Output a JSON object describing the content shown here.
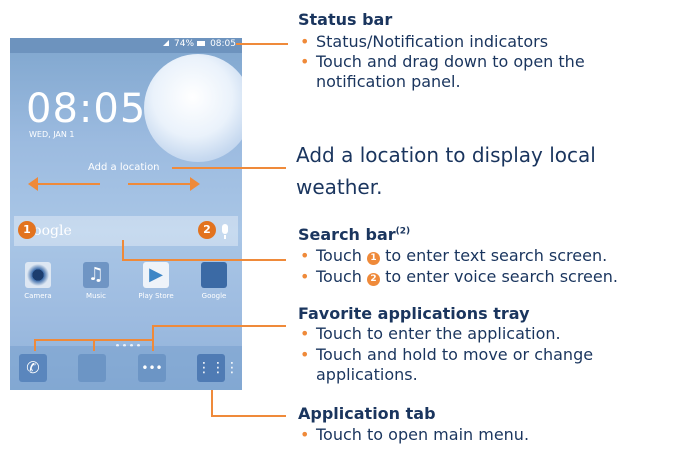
{
  "phone": {
    "battery": "74%",
    "time": "08:05",
    "clock": "08:05",
    "date": "WED, JAN 1",
    "add_location": "Add a location",
    "search_brand": "Google",
    "apps": [
      "Camera",
      "Music",
      "Play Store",
      "Google"
    ],
    "badges": [
      "1",
      "2"
    ]
  },
  "annotations": {
    "status_bar": {
      "title": "Status bar",
      "items": [
        "Status/Notification indicators",
        "Touch and drag down to open the",
        "notification panel."
      ]
    },
    "location": {
      "line1": "Add a location to display local",
      "line2": "weather."
    },
    "search_bar": {
      "title": "Search bar",
      "footnote": "(2)",
      "item1_pre": "Touch",
      "item1_num": "1",
      "item1_post": "to enter text search screen.",
      "item2_pre": "Touch",
      "item2_num": "2",
      "item2_post": "to enter voice search screen."
    },
    "favorites": {
      "title": "Favorite applications tray",
      "items": [
        "Touch to enter the application.",
        "Touch and hold to move or change",
        "applications."
      ]
    },
    "app_tab": {
      "title": "Application tab",
      "items": [
        "Touch to open main menu."
      ]
    }
  },
  "colors": {
    "accent": "#ef8a3a",
    "text": "#1a355e"
  }
}
